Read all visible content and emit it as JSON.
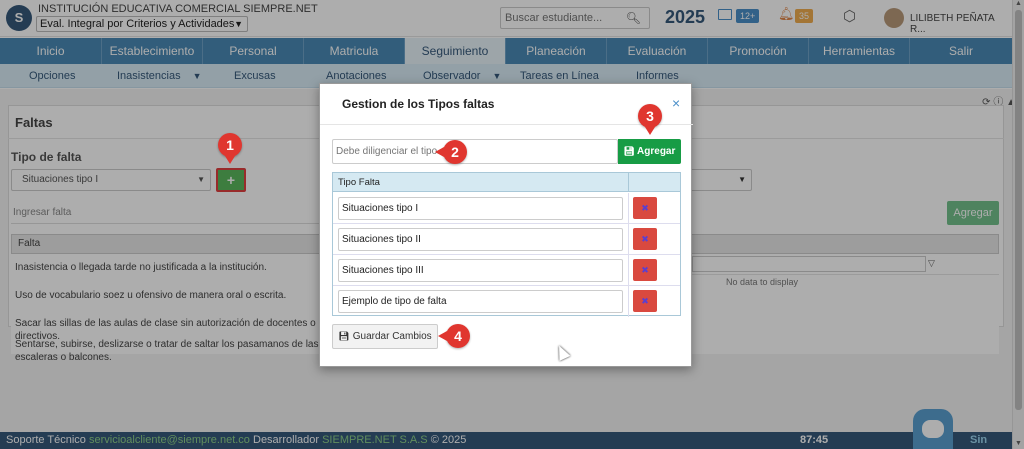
{
  "app": {
    "school_name": "INSTITUCIÓN EDUCATIVA COMERCIAL SIEMPRE.NET",
    "period": "Eval. Integral por Criterios y Actividades",
    "search_placeholder": "Buscar estudiante...",
    "year": "2025",
    "mail_count": "12+",
    "notif_count": "35",
    "user_name": "LILIBETH PEÑATA R..."
  },
  "nav": {
    "main": [
      {
        "label": "Inicio"
      },
      {
        "label": "Establecimiento"
      },
      {
        "label": "Personal"
      },
      {
        "label": "Matricula"
      },
      {
        "label": "Seguimiento",
        "active": true
      },
      {
        "label": "Planeación"
      },
      {
        "label": "Evaluación"
      },
      {
        "label": "Promoción"
      },
      {
        "label": "Herramientas"
      },
      {
        "label": "Salir"
      }
    ],
    "sub": [
      {
        "label": "Opciones"
      },
      {
        "label": "Inasistencias"
      },
      {
        "label": "Excusas"
      },
      {
        "label": "Anotaciones"
      },
      {
        "label": "Observador"
      },
      {
        "label": "Tareas en Línea"
      },
      {
        "label": "Informes"
      }
    ]
  },
  "page": {
    "title": "Faltas",
    "field_label": "Tipo de falta",
    "selected_type": "Situaciones tipo I",
    "add_symbol": "+",
    "falta_placeholder": "Ingresar falta",
    "agregar_label": "Agregar",
    "grid_header": "Falta",
    "no_data": "No data to display",
    "rows": [
      "Inasistencia o llegada tarde no justificada a la institución.",
      "Uso de vocabulario soez u ofensivo de manera oral o escrita.",
      "Sacar las sillas de las aulas de clase sin autorización de docentes o directivos.",
      "Sentarse, subirse, deslizarse o tratar de saltar los pasamanos de las escaleras o balcones."
    ]
  },
  "modal": {
    "title": "Gestion de los Tipos faltas",
    "close_symbol": "×",
    "input_placeholder": "Debe diligenciar el tipo",
    "agregar_label": "Agregar",
    "column_header": "Tipo Falta",
    "types": [
      "Situaciones tipo I",
      "Situaciones tipo II",
      "Situaciones tipo III",
      "Ejemplo de tipo de falta"
    ],
    "delete_symbol": "✖",
    "guardar_label": "Guardar Cambios"
  },
  "callouts": [
    "1",
    "2",
    "3",
    "4"
  ],
  "footer": {
    "support_label": "Soporte Técnico",
    "email": "servicioalcliente@siempre.net.co",
    "dev_label": "Desarrollador",
    "brand": "SIEMPRE.NET S.A.S",
    "copyright": "© 2025",
    "time": "87:45",
    "sin": "Sin"
  },
  "colors": {
    "primary": "#4a8ab5",
    "dark": "#35597b",
    "success": "#179c45",
    "danger": "#d9493f",
    "callout": "#e0362f"
  }
}
